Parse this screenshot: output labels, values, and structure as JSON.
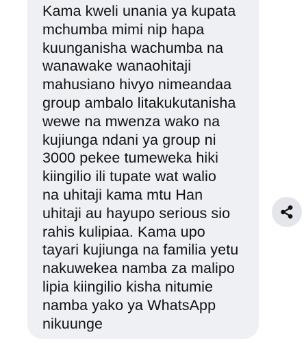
{
  "message": {
    "text": "Kama kweli unania ya kupata\nmchumba mimi nip hapa\nkuunganisha wachumba na\nwanawake wanaohitaji\nmahusiano hivyo nimeandaa\ngroup ambalo litakukutanisha\nwewe na mwenza wako na\nkujiunga ndani ya group ni\n3000 pekee tumeweka hiki\nkiingilio ili tupate wat walio\nna uhitaji kama mtu Han\nuhitaji au hayupo serious sio\nrahis kulipiaa. Kama upo\ntayari kujiunga na familia yetu\nnakuwekea namba za malipo\nlipia kiingilio kisha nitumie\nnamba yako ya WhatsApp\nnikuunge"
  },
  "share_button": {
    "icon": "share-icon"
  },
  "colors": {
    "bubble_background": "#eef0f3",
    "text": "#111111",
    "share_button_background": "#e4e6eb",
    "share_icon": "#111111"
  }
}
